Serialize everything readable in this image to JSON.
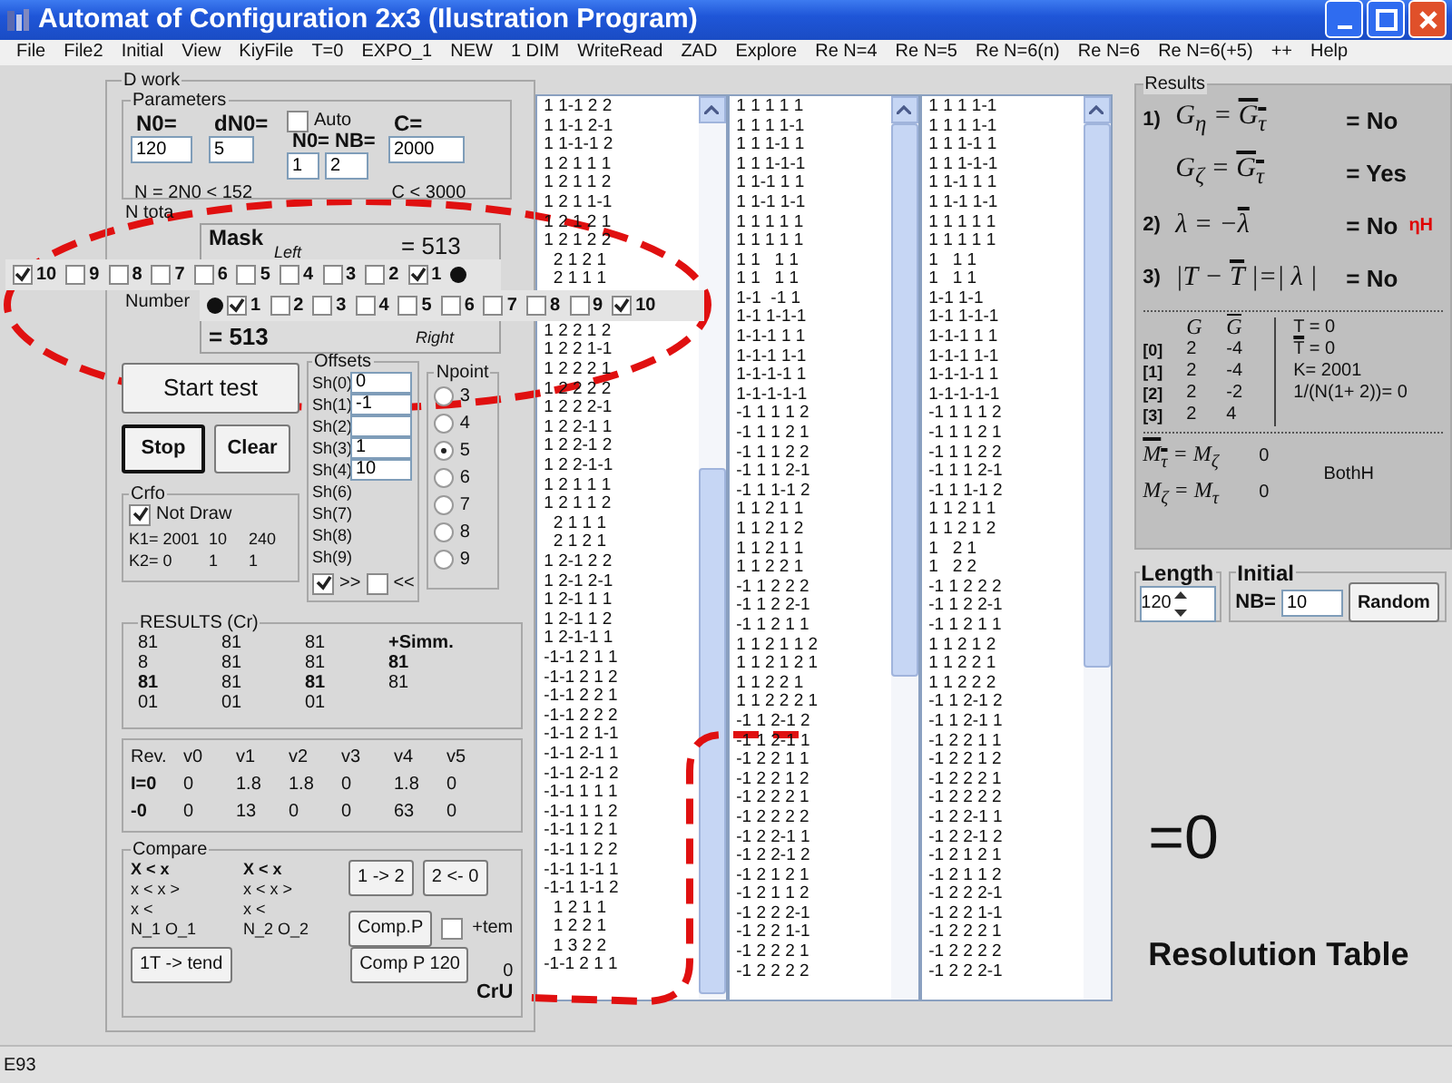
{
  "window": {
    "title": "Automat of Configuration 2x3 (Ilustration Program)"
  },
  "menu": [
    "File",
    "File2",
    "Initial",
    "View",
    "KiyFile",
    "T=0",
    "EXPO_1",
    "NEW",
    "1 DIM",
    "WriteRead",
    "ZAD",
    "Explore",
    "Re N=4",
    "Re N=5",
    "Re N=6(n)",
    "Re N=6",
    "Re N=6(+5)",
    "++",
    "Help"
  ],
  "work": {
    "title": "D work",
    "parameters": {
      "title": "Parameters",
      "auto": {
        "label": "Auto",
        "checked": false
      },
      "n0_label": "N0=",
      "n0": "120",
      "dn0_label": "dN0=",
      "dn0": "5",
      "n0nb_label": "N0= NB=",
      "n0b": "1",
      "nb": "2",
      "c_label": "C=",
      "c": "2000",
      "n_limit": "N = 2N0 < 152",
      "c_limit": "C < 3000"
    },
    "ntota": [
      "N tota",
      "Number"
    ],
    "start_button": "Start test",
    "stop_button": "Stop",
    "clear_button": "Clear",
    "offsets": {
      "title": "Offsets",
      "rows": [
        {
          "kind": "input",
          "label": "Sh(0)",
          "value": "0"
        },
        {
          "kind": "input",
          "label": "Sh(1)",
          "value": "-1"
        },
        {
          "kind": "input",
          "label": "Sh(2)"
        },
        {
          "kind": "input",
          "label": "Sh(3)",
          "value": "1"
        },
        {
          "kind": "input",
          "label": "Sh(4)",
          "value": "10"
        },
        {
          "kind": "label",
          "label": "Sh(6)"
        },
        {
          "kind": "label",
          "label": "Sh(7)"
        },
        {
          "kind": "label",
          "label": "Sh(8)"
        },
        {
          "kind": "label",
          "label": "Sh(9)"
        }
      ],
      "forward": {
        "label": ">>",
        "checked": true
      },
      "back": {
        "label": "<<",
        "checked": false
      }
    },
    "npoint": {
      "title": "Npoint",
      "options": [
        {
          "label": "3",
          "selected": false
        },
        {
          "label": "4",
          "selected": false
        },
        {
          "label": "5",
          "selected": true
        },
        {
          "label": "6",
          "selected": false
        },
        {
          "label": "7",
          "selected": false
        },
        {
          "label": "8",
          "selected": false
        },
        {
          "label": "9",
          "selected": false
        }
      ]
    },
    "crfo": {
      "title": "Crfo",
      "not_draw": {
        "label": "Not Draw",
        "checked": true
      },
      "rows": [
        [
          "K1= 2001",
          "10",
          "240"
        ],
        [
          "K2= 0",
          "1",
          "1"
        ]
      ]
    },
    "results_cr": {
      "title": "RESULTS (Cr)",
      "rows": [
        [
          {
            "text": "81",
            "bold": false
          },
          {
            "text": "81",
            "bold": false
          },
          {
            "text": "81",
            "bold": false
          },
          {
            "text": "+Simm.",
            "bold": true
          }
        ],
        [
          {
            "text": "8",
            "bold": false
          },
          {
            "text": "81",
            "bold": false
          },
          {
            "text": "81",
            "bold": false
          },
          {
            "text": "81",
            "bold": true
          }
        ],
        [
          {
            "text": "81",
            "bold": true
          },
          {
            "text": "81",
            "bold": false
          },
          {
            "text": "81",
            "bold": true
          },
          {
            "text": "81",
            "bold": false
          }
        ],
        [
          {
            "text": "01",
            "bold": false
          },
          {
            "text": "01",
            "bold": false
          },
          {
            "text": "01",
            "bold": false
          }
        ]
      ]
    },
    "rev": {
      "header": [
        "Rev.",
        "v0",
        "v1",
        "v2",
        "v3",
        "v4",
        "v5"
      ],
      "rows": [
        [
          "I=0",
          "0",
          "1.8",
          "1.8",
          "0",
          "1.8",
          "0"
        ],
        [
          "-0",
          "0",
          "13",
          "0",
          "0",
          "63",
          "0"
        ]
      ]
    },
    "compare": {
      "title": "Compare",
      "blocks": [
        [
          "X < x",
          "x < x >",
          "x <",
          "N_1 O_1"
        ],
        [
          "X < x",
          "x < x >",
          "x <",
          "N_2 O_2"
        ]
      ],
      "to2_button": "1 -> 2",
      "from0_button": "2 <- 0",
      "compp_button": "Comp.P",
      "tem": {
        "label": "+tem",
        "checked": false
      },
      "tend_button": "1T -> tend",
      "comp120_button": "Comp P 120",
      "count": "0",
      "cru": "CrU"
    }
  },
  "mask": {
    "title": "Mask",
    "left_label": "Left",
    "left_sum": "= 513",
    "left_boxes": [
      {
        "label": "10",
        "checked": true
      },
      {
        "label": "9",
        "checked": false
      },
      {
        "label": "8",
        "checked": false
      },
      {
        "label": "7",
        "checked": false
      },
      {
        "label": "6",
        "checked": false
      },
      {
        "label": "5",
        "checked": false
      },
      {
        "label": "4",
        "checked": false
      },
      {
        "label": "3",
        "checked": false
      },
      {
        "label": "2",
        "checked": false
      },
      {
        "label": "1",
        "checked": true
      }
    ],
    "right_boxes": [
      {
        "label": "1",
        "checked": true
      },
      {
        "label": "2",
        "checked": false
      },
      {
        "label": "3",
        "checked": false
      },
      {
        "label": "4",
        "checked": false
      },
      {
        "label": "5",
        "checked": false
      },
      {
        "label": "6",
        "checked": false
      },
      {
        "label": "7",
        "checked": false
      },
      {
        "label": "8",
        "checked": false
      },
      {
        "label": "9",
        "checked": false
      },
      {
        "label": "10",
        "checked": true
      }
    ],
    "right_sum": "= 513",
    "right_label": "Right"
  },
  "lists": [
    [
      "1 1-1 2 2",
      "1 1-1 2-1",
      "1 1-1-1 2",
      "1 2 1 1 1",
      "1 2 1 1 2",
      "1 2 1 1-1",
      "1 2 1 2 1",
      "1 2 1 2 2",
      "  2 1 2 1",
      "  2 1 1 1",
      "1 2 2 1 2",
      "1 2 2 1-1",
      "1 2 2 2 1",
      "1 2 2 2 2",
      "1 2 2 2-1",
      "1 2 2-1 1",
      "1 2 2-1 2",
      "1 2 2-1-1",
      "1 2 1 1 1",
      "1 2 1 1 2",
      "  2 1 1 1",
      "  2 1 2 1",
      "1 2-1 2 2",
      "1 2-1 2-1",
      "1 2-1 1 1",
      "1 2-1 1 2",
      "1 2-1-1 1",
      "-1-1 2 1 1",
      "-1-1 2 1 2",
      "-1-1 2 2 1",
      "-1-1 2 2 2",
      "-1-1 2 1-1",
      "-1-1 2-1 1",
      "-1-1 2-1 2",
      "-1-1 1 1 1",
      "-1-1 1 1 2",
      "-1-1 1 2 1",
      "-1-1 1 2 2",
      "-1-1 1-1 1",
      "-1-1 1-1 2",
      "  1 2 1 1",
      "  1 2 2 1",
      "  1 3 2 2",
      "-1-1 2 1 1"
    ],
    [
      "1 1 1 1 1",
      "1 1 1 1-1",
      "1 1 1-1 1",
      "1 1 1-1-1",
      "1 1-1 1 1",
      "1 1-1 1-1",
      "1 1 1 1 1",
      "1 1 1 1 1",
      "1 1   1 1",
      "1 1   1 1",
      "1-1  -1 1",
      "1-1 1-1-1",
      "1-1-1 1 1",
      "1-1-1 1-1",
      "1-1-1-1 1",
      "1-1-1-1-1",
      "-1 1 1 1 2",
      "-1 1 1 2 1",
      "-1 1 1 2 2",
      "-1 1 1 2-1",
      "-1 1 1-1 2",
      "1 1 2 1 1",
      "1 1 2 1 2",
      "1 1 2 1 1",
      "1 1 2 2 1",
      "-1 1 2 2 2",
      "-1 1 2 2-1",
      "-1 1 2 1 1",
      "1 1 2 1 1 2",
      "1 1 2 1 2 1",
      "1 1 2 2 1",
      "1 1 2 2 2 1",
      "-1 1 2-1 2",
      "-1 1 2-1 1",
      "-1 2 2 1 1",
      "-1 2 2 1 2",
      "-1 2 2 2 1",
      "-1 2 2 2 2",
      "-1 2 2-1 1",
      "-1 2 2-1 2",
      "-1 2 1 2 1",
      "-1 2 1 1 2",
      "-1 2 2 2-1",
      "-1 2 2 1-1",
      "-1 2 2 2 1",
      "-1 2 2 2 2"
    ],
    [
      "1 1 1 1-1",
      "1 1 1 1-1",
      "1 1 1-1 1",
      "1 1 1-1-1",
      "1 1-1 1 1",
      "1 1-1 1-1",
      "1 1 1 1 1",
      "1 1 1 1 1",
      "1   1 1",
      "1   1 1",
      "1-1 1-1",
      "1-1 1-1-1",
      "1-1-1 1 1",
      "1-1-1 1-1",
      "1-1-1-1 1",
      "1-1-1-1-1",
      "-1 1 1 1 2",
      "-1 1 1 2 1",
      "-1 1 1 2 2",
      "-1 1 1 2-1",
      "-1 1 1-1 2",
      "1 1 2 1 1",
      "1 1 2 1 2",
      "1   2 1",
      "1   2 2",
      "-1 1 2 2 2",
      "-1 1 2 2-1",
      "-1 1 2 1 1",
      "1 1 2 1 2",
      "1 1 2 2 1",
      "1 1 2 2 2",
      "-1 1 2-1 2",
      "-1 1 2-1 1",
      "-1 2 2 1 1",
      "-1 2 2 1 2",
      "-1 2 2 2 1",
      "-1 2 2 2 2",
      "-1 2 2-1 1",
      "-1 2 2-1 2",
      "-1 2 1 2 1",
      "-1 2 1 1 2",
      "-1 2 2 2-1",
      "-1 2 2 1-1",
      "-1 2 2 2 1",
      "-1 2 2 2 2",
      "-1 2 2 2-1"
    ]
  ],
  "results": {
    "title": "Results",
    "checks": [
      {
        "number": "1)",
        "formula": [
          {
            "text": "G",
            "sub": "η"
          },
          {
            "text": " = "
          },
          {
            "text": "G",
            "sub": "τ",
            "overline": true
          }
        ],
        "answer": "= No"
      },
      {
        "formula": [
          {
            "text": "G",
            "sub": "ζ"
          },
          {
            "text": " = "
          },
          {
            "text": "G",
            "sub": "τ",
            "overline": true
          }
        ],
        "answer": "= Yes"
      },
      {
        "number": "2)",
        "formula": [
          {
            "text": "λ = −"
          },
          {
            "text": "λ",
            "overline": true
          }
        ],
        "answer": "= No",
        "note": "ηH"
      },
      {
        "number": "3)",
        "formula": [
          {
            "text": "|T − "
          },
          {
            "text": "T",
            "overline": true
          },
          {
            "text": " |=| λ |"
          }
        ],
        "answer": "= No"
      }
    ],
    "table_header": [
      {
        "text": "G"
      },
      {
        "text": "G",
        "overline": true
      }
    ],
    "t_eq": "T = 0",
    "rows": [
      [
        "[0]",
        "2",
        "-4"
      ],
      [
        "[1]",
        "2",
        "-4"
      ],
      [
        "[2]",
        "2",
        "-2"
      ],
      [
        "[3]",
        "2",
        "4"
      ]
    ],
    "tbar": [
      {
        "text": "T",
        "overline": true
      },
      {
        "text": " = 0"
      }
    ],
    "k": "K= 2001",
    "ratio": "1/(N(1+ 2))= 0",
    "moments": [
      {
        "formula": [
          {
            "text": "M",
            "sub": "τ",
            "overline": true
          },
          {
            "text": " = "
          },
          {
            "text": "M",
            "sub": "ζ"
          }
        ],
        "value": "0"
      },
      {
        "formula": [
          {
            "text": "M",
            "sub": "ζ"
          },
          {
            "text": " = "
          },
          {
            "text": "M",
            "sub": "τ"
          }
        ],
        "value": "0"
      }
    ],
    "both": "BothH"
  },
  "length": {
    "title": "Length",
    "value": "120"
  },
  "initial": {
    "title": "Initial",
    "nb_label": "NB=",
    "nb": "10",
    "random_button": "Random"
  },
  "big_value": "=0",
  "caption": "Resolution Table",
  "status": "E93"
}
